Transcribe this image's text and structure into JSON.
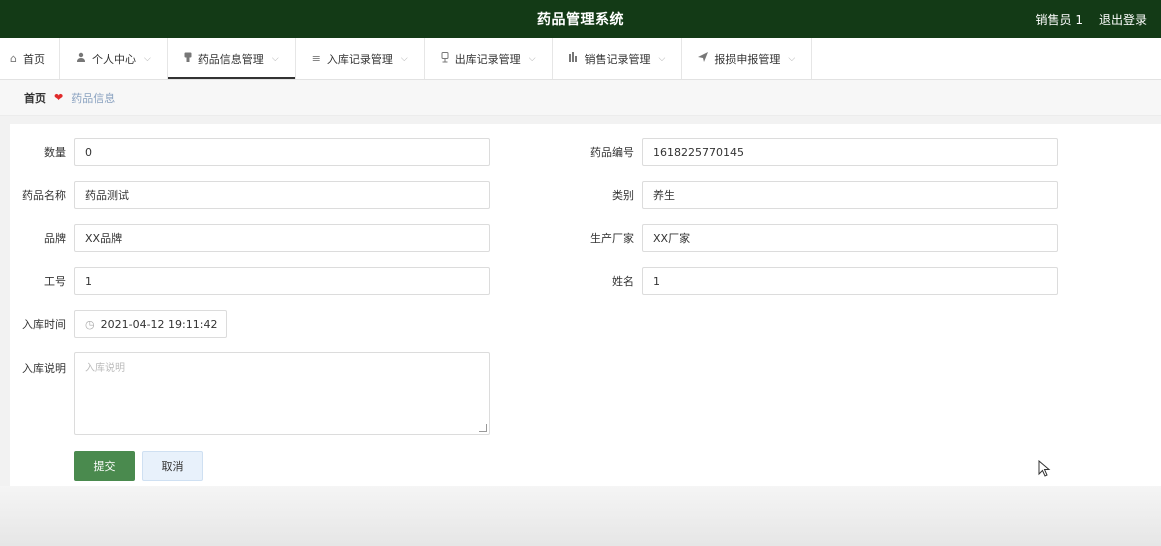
{
  "header": {
    "title": "药品管理系统",
    "user": "销售员 1",
    "logout": "退出登录"
  },
  "nav": [
    {
      "label": "首页",
      "icon": "home-icon",
      "glyph": "⌂",
      "caret": ""
    },
    {
      "label": "个人中心",
      "icon": "user-icon",
      "glyph": "👤",
      "caret": "⌵"
    },
    {
      "label": "药品信息管理",
      "icon": "pill-icon",
      "glyph": "▼",
      "caret": "⌵"
    },
    {
      "label": "入库记录管理",
      "icon": "list-icon",
      "glyph": "≡",
      "caret": "⌵"
    },
    {
      "label": "出库记录管理",
      "icon": "cup-icon",
      "glyph": "♁",
      "caret": "⌵"
    },
    {
      "label": "销售记录管理",
      "icon": "bar-chart-icon",
      "glyph": "▮",
      "caret": "⌵"
    },
    {
      "label": "报损申报管理",
      "icon": "send-icon",
      "glyph": "➶",
      "caret": "⌵"
    }
  ],
  "breadcrumb": {
    "home": "首页",
    "current": "药品信息"
  },
  "form": {
    "quantity_label": "数量",
    "quantity_value": "0",
    "code_label": "药品编号",
    "code_value": "1618225770145",
    "name_label": "药品名称",
    "name_value": "药品测试",
    "category_label": "类别",
    "category_value": "养生",
    "brand_label": "品牌",
    "brand_value": "XX品牌",
    "maker_label": "生产厂家",
    "maker_value": "XX厂家",
    "worker_id_label": "工号",
    "worker_id_value": "1",
    "worker_name_label": "姓名",
    "worker_name_value": "1",
    "time_label": "入库时间",
    "time_value": "2021-04-12 19:11:42",
    "desc_label": "入库说明",
    "desc_placeholder": "入库说明"
  },
  "buttons": {
    "submit": "提交",
    "cancel": "取消"
  },
  "colors": {
    "header_bg": "#133a16",
    "submit_bg": "#4a8a4e",
    "heart": "#e02a2a"
  }
}
